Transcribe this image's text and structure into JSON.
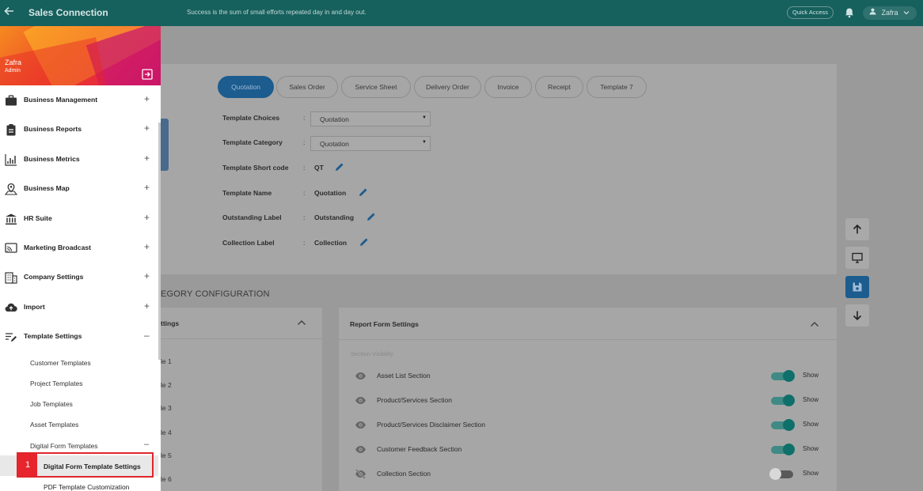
{
  "topbar": {
    "app_title": "Sales Connection",
    "tagline": "Success is the sum of small efforts repeated day in and day out.",
    "quick_access": "Quick Access",
    "user_name": "Zafra"
  },
  "sidebar": {
    "user_name": "Zafra",
    "user_role": "Admin",
    "items": [
      {
        "label": "Business Management",
        "expander": "+"
      },
      {
        "label": "Business Reports",
        "expander": "+"
      },
      {
        "label": "Business Metrics",
        "expander": "+"
      },
      {
        "label": "Business Map",
        "expander": "+"
      },
      {
        "label": "HR Suite",
        "expander": "+"
      },
      {
        "label": "Marketing Broadcast",
        "expander": "+"
      },
      {
        "label": "Company Settings",
        "expander": "+"
      },
      {
        "label": "Import",
        "expander": "+"
      },
      {
        "label": "Template Settings",
        "expander": "–"
      }
    ],
    "template_sub": [
      {
        "label": "Customer Templates"
      },
      {
        "label": "Project Templates"
      },
      {
        "label": "Job Templates"
      },
      {
        "label": "Asset Templates"
      },
      {
        "label": "Digital Form Templates",
        "expander": "–"
      }
    ],
    "digital_sub": [
      {
        "label": "Digital Form Template Settings"
      },
      {
        "label": "PDF Template Customization"
      }
    ],
    "highlight_number": "1"
  },
  "tabs": [
    "Quotation",
    "Sales Order",
    "Service Sheet",
    "Delivery Order",
    "Invoice",
    "Receipt",
    "Template 7"
  ],
  "form": {
    "template_choices_label": "Template Choices",
    "template_choices_value": "Quotation",
    "template_category_label": "Template Category",
    "template_category_value": "Quotation",
    "short_code_label": "Template Short code",
    "short_code_value": "QT",
    "name_label": "Template Name",
    "name_value": "Quotation",
    "outstanding_label": "Outstanding Label",
    "outstanding_value": "Outstanding",
    "collection_label": "Collection Label",
    "collection_value": "Collection",
    "colon": ":"
  },
  "category_config_title": "EGORY CONFIGURATION",
  "left_card": {
    "header": "ttings",
    "rows": [
      "le 1",
      "le 2",
      "le 3",
      "le 4",
      "le 5",
      "le 6"
    ]
  },
  "report_form": {
    "header": "Report Form Settings",
    "section_visibility": "Section Visibility",
    "rows": [
      {
        "label": "Asset List Section",
        "state": "Show",
        "on": true
      },
      {
        "label": "Product/Services Section",
        "state": "Show",
        "on": true
      },
      {
        "label": "Product/Services Disclaimer Section",
        "state": "Show",
        "on": true
      },
      {
        "label": "Customer Feedback Section",
        "state": "Show",
        "on": true
      },
      {
        "label": "Collection Section",
        "state": "Show",
        "on": false
      }
    ]
  },
  "colors": {
    "topbar": "#16605d",
    "active_tab": "#1c5c8f",
    "toggle_on": "#0f6f6a",
    "highlight": "#e0262b"
  }
}
